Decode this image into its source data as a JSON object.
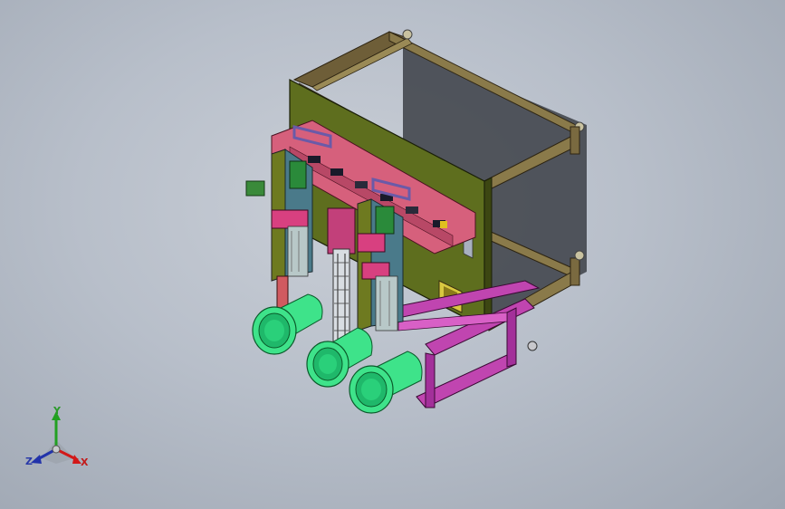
{
  "triad": {
    "x_label": "X",
    "y_label": "Y",
    "z_label": "Z",
    "x_color": "#d21818",
    "y_color": "#22a022",
    "z_color": "#2233aa"
  },
  "colors": {
    "frame_plate": "#5a6a1c",
    "rails": "#7a6a40",
    "base_frame": "#b53aa8",
    "pcb": "#d65a7a",
    "nozzles": "#3ee38a",
    "brackets": "#6a5aa8"
  }
}
